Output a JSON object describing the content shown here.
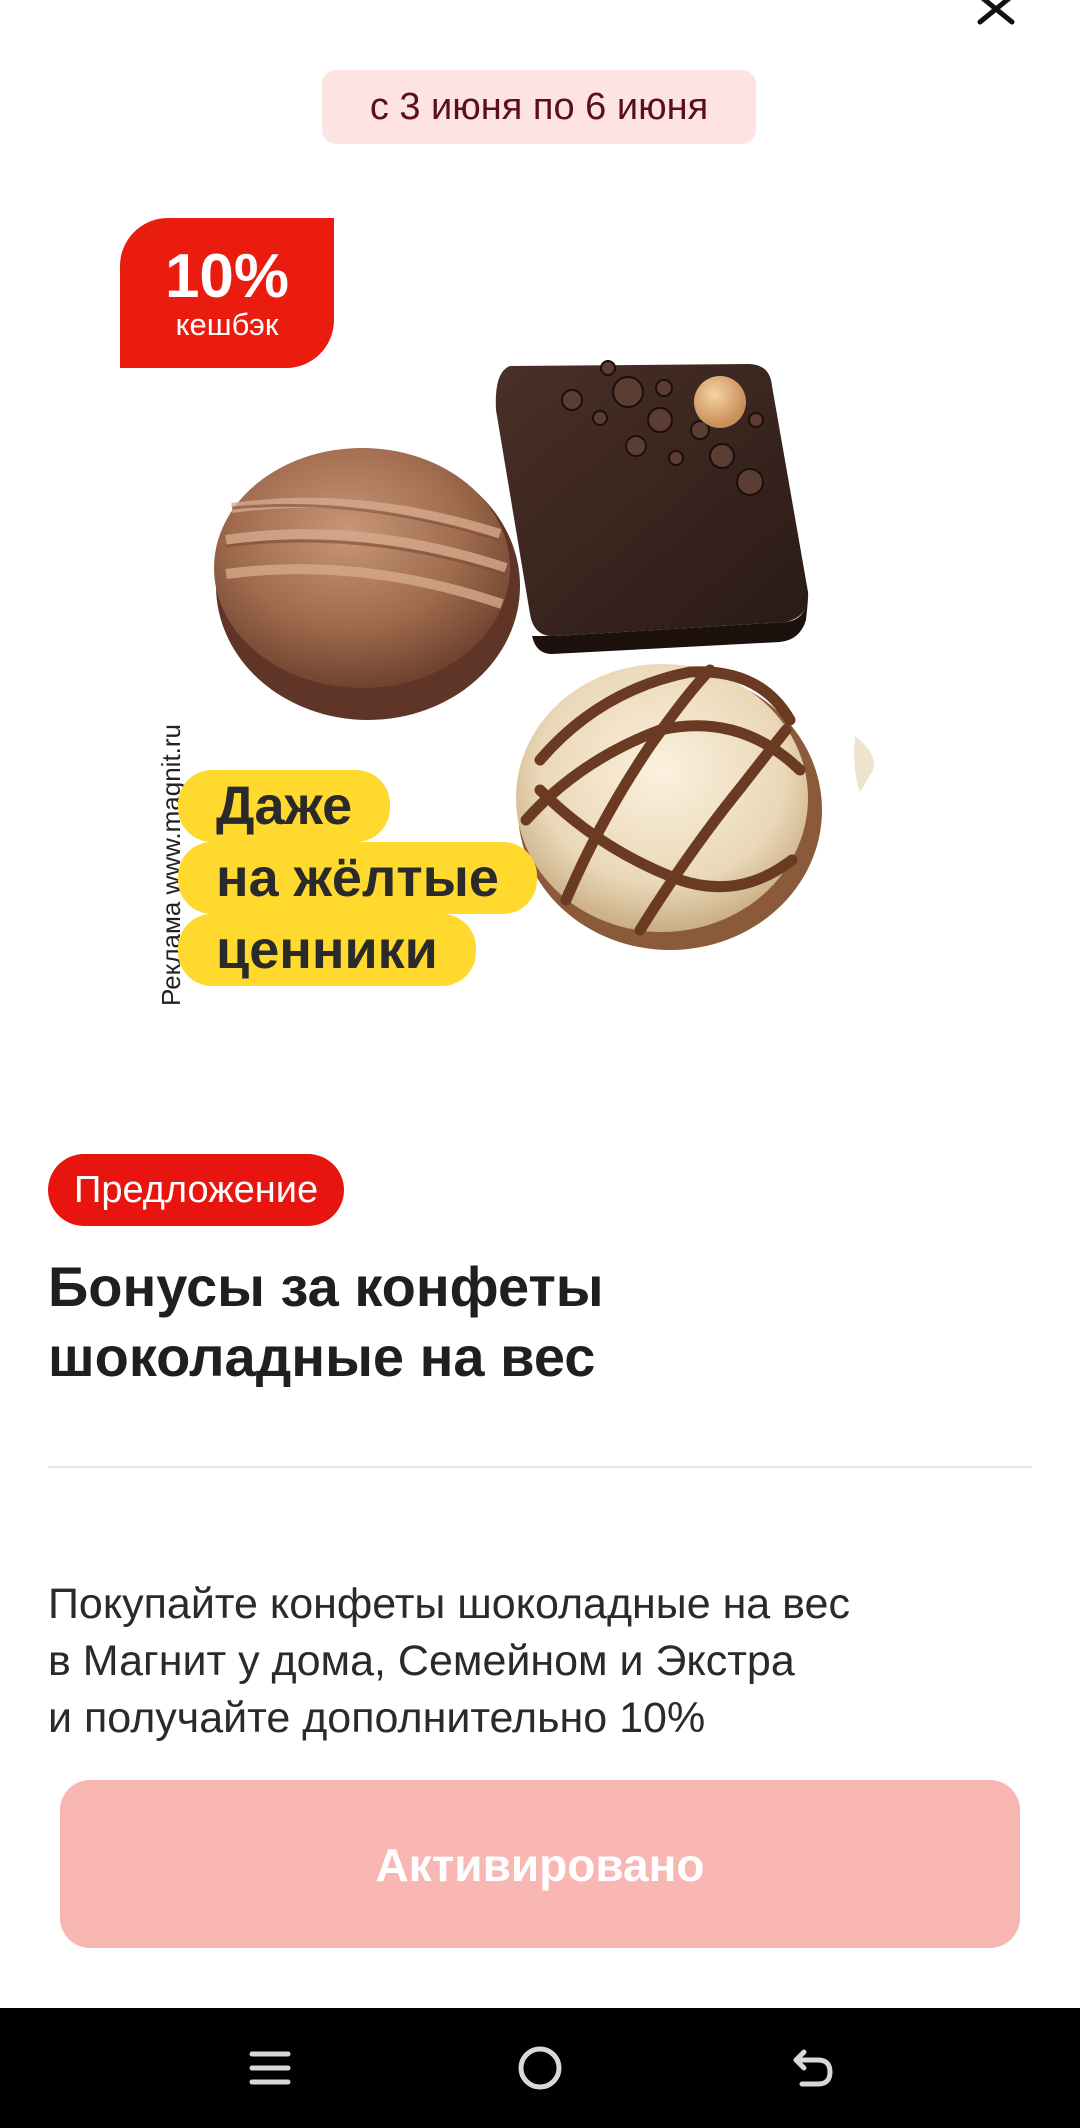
{
  "header": {
    "close_icon": "close-icon",
    "date_range": "с 3 июня по 6 июня"
  },
  "banner": {
    "cashback_value": "10%",
    "cashback_label": "кешбэк",
    "ad_label": "Реклама www.magnit.ru",
    "slogan_lines": [
      "Даже",
      "на жёлтые",
      "ценники"
    ],
    "image": "chocolate-candies-image"
  },
  "offer": {
    "chip_label": "Предложение",
    "title_lines": [
      "Бонусы за конфеты",
      "шоколадные на вес"
    ],
    "description_lines": [
      "Покупайте конфеты шоколадные на вес",
      "в Магнит у дома, Семейном и Экстра",
      "и получайте дополнительно 10%"
    ],
    "button_label": "Активировано"
  },
  "navbar": {
    "icons": [
      "menu-icon",
      "home-icon",
      "back-icon"
    ]
  },
  "colors": {
    "accent_red": "#ea1c0f",
    "date_pill_bg": "#fde3e2",
    "slogan_yellow": "#ffd92e",
    "button_disabled": "#f9b7b3"
  }
}
